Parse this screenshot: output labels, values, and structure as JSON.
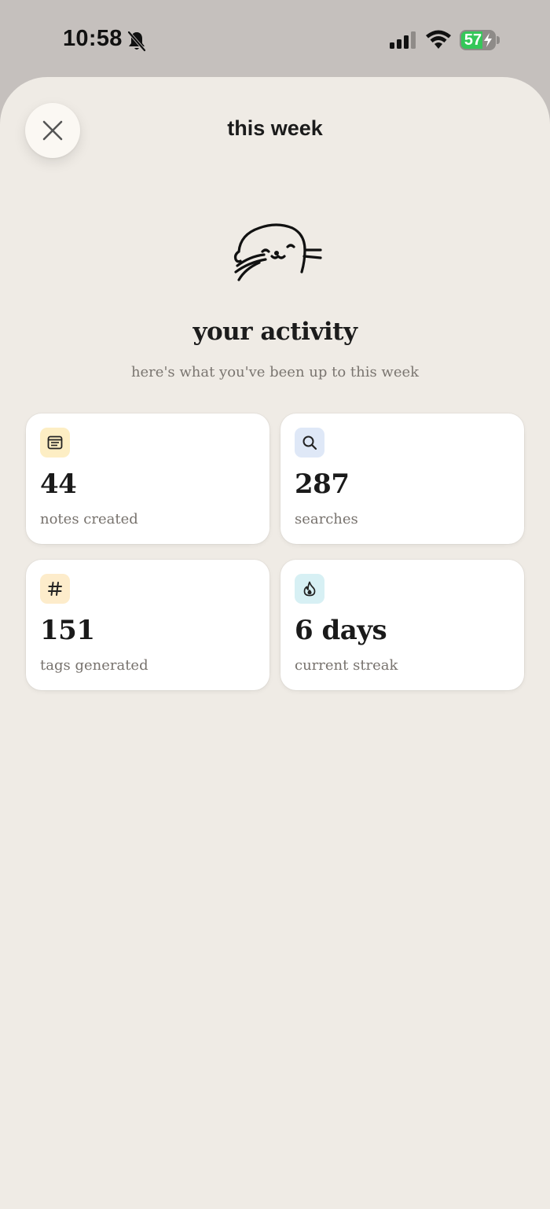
{
  "status_bar": {
    "time": "10:58",
    "battery": "57"
  },
  "sheet": {
    "title": "this week"
  },
  "hero": {
    "heading": "your activity",
    "subheading": "here's what you've been up to this week"
  },
  "stats": [
    {
      "icon": "notes-icon",
      "icon_bg": "#fdeec4",
      "value": "44",
      "label": "notes created"
    },
    {
      "icon": "search-icon",
      "icon_bg": "#dfe8f7",
      "value": "287",
      "label": "searches"
    },
    {
      "icon": "hash-icon",
      "icon_bg": "#fdeccb",
      "value": "151",
      "label": "tags generated"
    },
    {
      "icon": "flame-icon",
      "icon_bg": "#d7f0f4",
      "value": "6 days",
      "label": "current streak"
    }
  ],
  "colors": {
    "sheet_background": "#efebe5",
    "status_background": "#c5c0bd",
    "battery_green": "#35c759"
  }
}
